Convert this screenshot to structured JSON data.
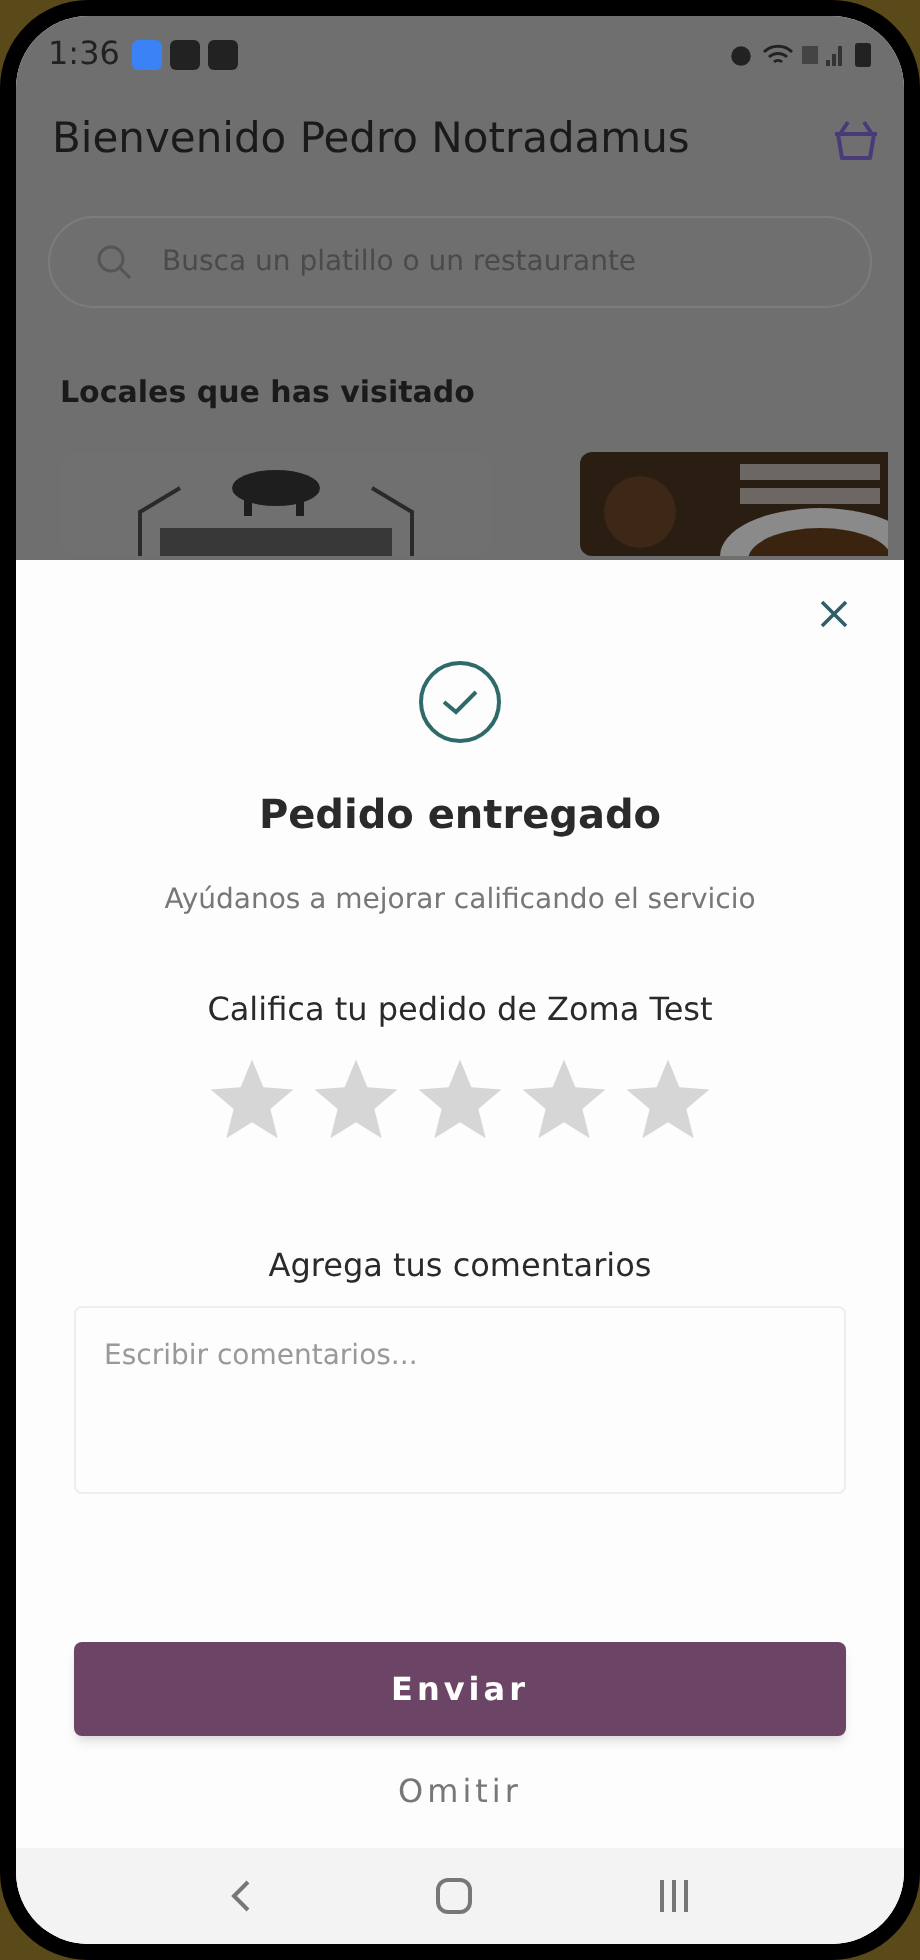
{
  "status_bar": {
    "time": "1:36"
  },
  "header": {
    "title": "Bienvenido Pedro Notradamus"
  },
  "search": {
    "placeholder": "Busca un platillo o un restaurante"
  },
  "visited": {
    "title": "Locales que has visitado"
  },
  "modal": {
    "title": "Pedido entregado",
    "subtitle": "Ayúdanos a mejorar calificando el servicio",
    "rating_prompt": "Califica tu pedido de Zoma Test",
    "stars": 0,
    "comments_label": "Agrega tus comentarios",
    "comments": {
      "placeholder": "Escribir comentarios..."
    },
    "submit": "Enviar",
    "skip": "Omitir"
  }
}
